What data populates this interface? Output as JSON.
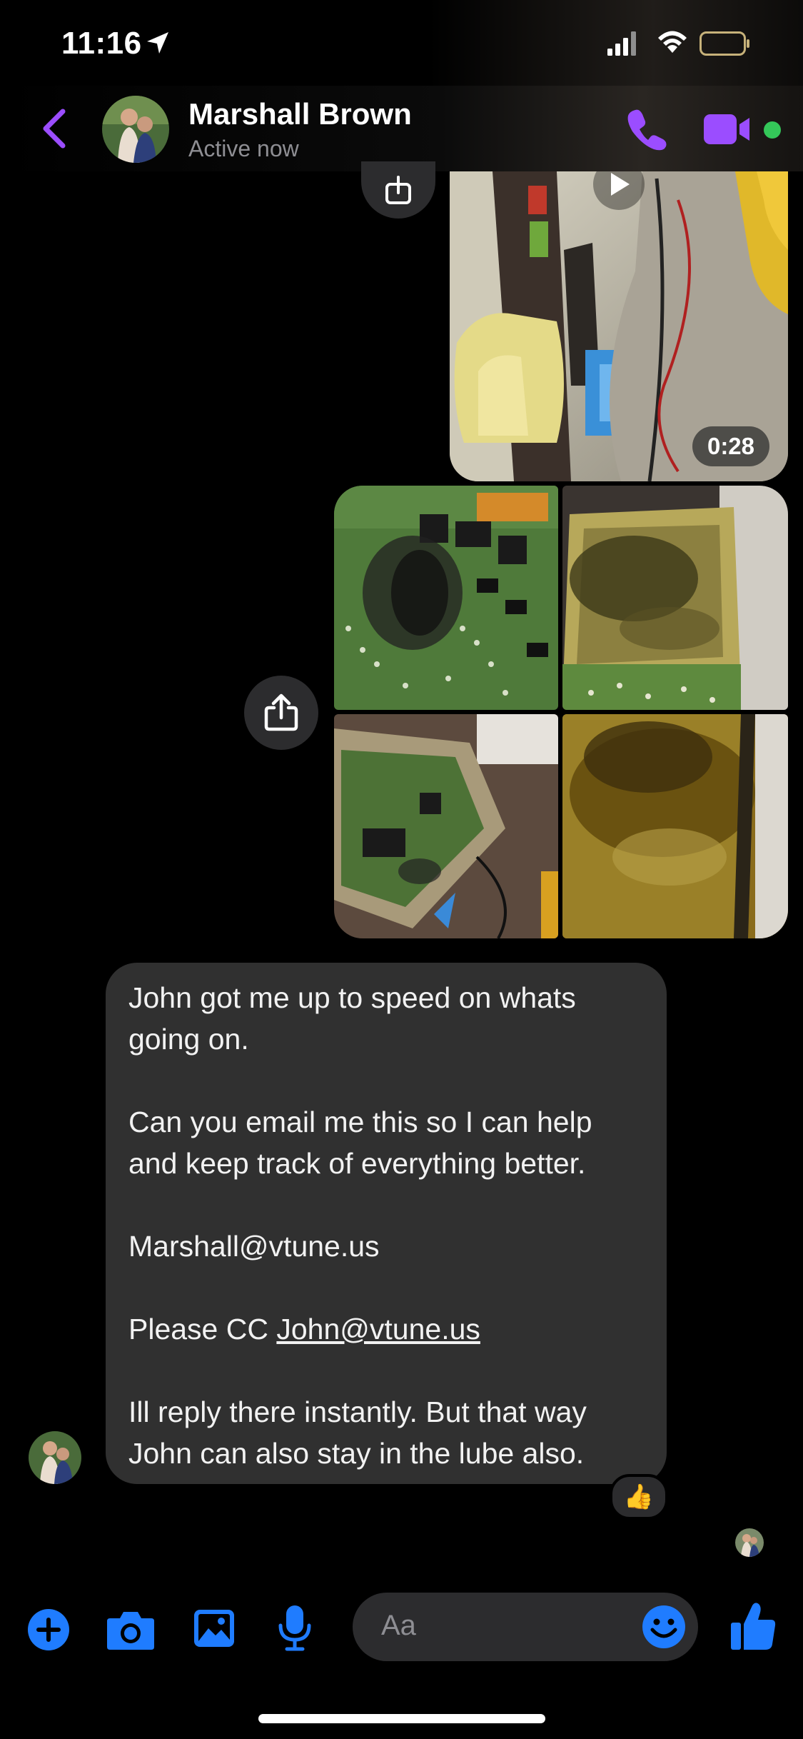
{
  "status_bar": {
    "time": "11:16"
  },
  "header": {
    "contact_name": "Marshall Brown",
    "contact_status": "Active now",
    "accent_color": "#9b4dff",
    "online_color": "#34c759"
  },
  "media": {
    "video_duration": "0:28"
  },
  "message": {
    "lines": [
      "John got me up to speed on whats",
      "going on.",
      "Can you email me this so I can help",
      "and keep track of everything better.",
      "Marshall@vtune.us",
      "Please CC ",
      "John@vtune.us",
      "Ill reply there instantly. But that way",
      "John can also stay in the lube also."
    ],
    "reaction": "👍"
  },
  "composer": {
    "placeholder": "Aa",
    "accent_color": "#1f7cff"
  }
}
